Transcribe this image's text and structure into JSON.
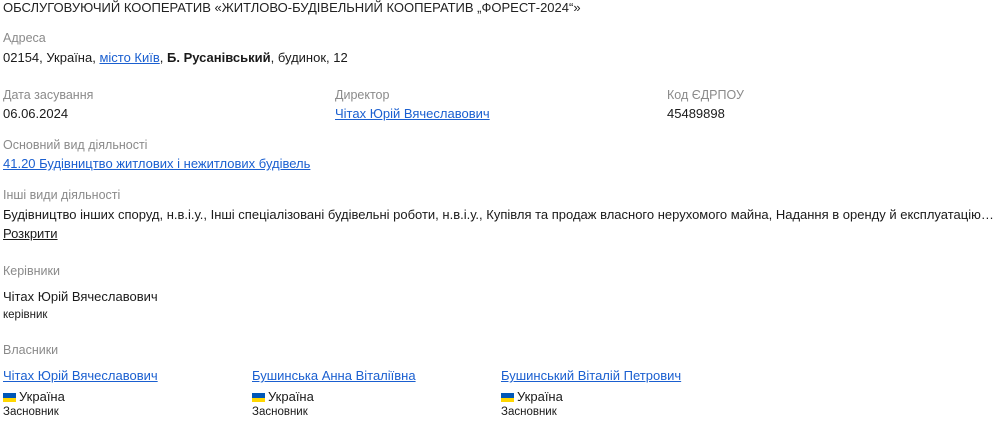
{
  "company": {
    "title": "ОБСЛУГОВУЮЧИЙ КООПЕРАТИВ «ЖИТЛОВО-БУДІВЕЛЬНИЙ КООПЕРАТИВ „ФОРЕСТ-2024“»"
  },
  "address": {
    "label": "Адреса",
    "prefix": "02154, Україна, ",
    "city_link": "місто Київ",
    "comma": ", ",
    "street": "Б. Русанівський",
    "suffix": ", будинок, 12"
  },
  "founded": {
    "label": "Дата засування",
    "value": "06.06.2024"
  },
  "director": {
    "label": "Директор",
    "name": "Чітах Юрій Вячеславович"
  },
  "edrpou": {
    "label": "Код ЄДРПОУ",
    "value": "45489898"
  },
  "main_activity": {
    "label": "Основний вид діяльності",
    "value": "41.20 Будівництво житлових і нежитлових будівель"
  },
  "other_activities": {
    "label": "Інші види діяльності",
    "value": "Будівництво інших споруд, н.в.і.у., Інші спеціалізовані будівельні роботи, н.в.і.у., Купівля та продаж власного нерухомого майна, Надання в оренду й експлуатацію власного",
    "expand": "Розкрити"
  },
  "managers": {
    "label": "Керівники",
    "items": [
      {
        "name": "Чітах Юрій Вячеславович",
        "role": "керівник"
      }
    ]
  },
  "owners": {
    "label": "Власники",
    "items": [
      {
        "name": "Чітах Юрій Вячеславович",
        "country": "Україна",
        "role": "Засновник"
      },
      {
        "name": "Бушинська Анна Віталіївна",
        "country": "Україна",
        "role": "Засновник"
      },
      {
        "name": "Бушинський Віталій Петрович",
        "country": "Україна",
        "role": "Засновник"
      }
    ]
  },
  "icons": {
    "flag": "ukraine-flag-icon"
  },
  "colors": {
    "link": "#1a5fd0",
    "label": "#8a8a8a",
    "flag_blue": "#0057b7",
    "flag_yellow": "#ffd700"
  }
}
